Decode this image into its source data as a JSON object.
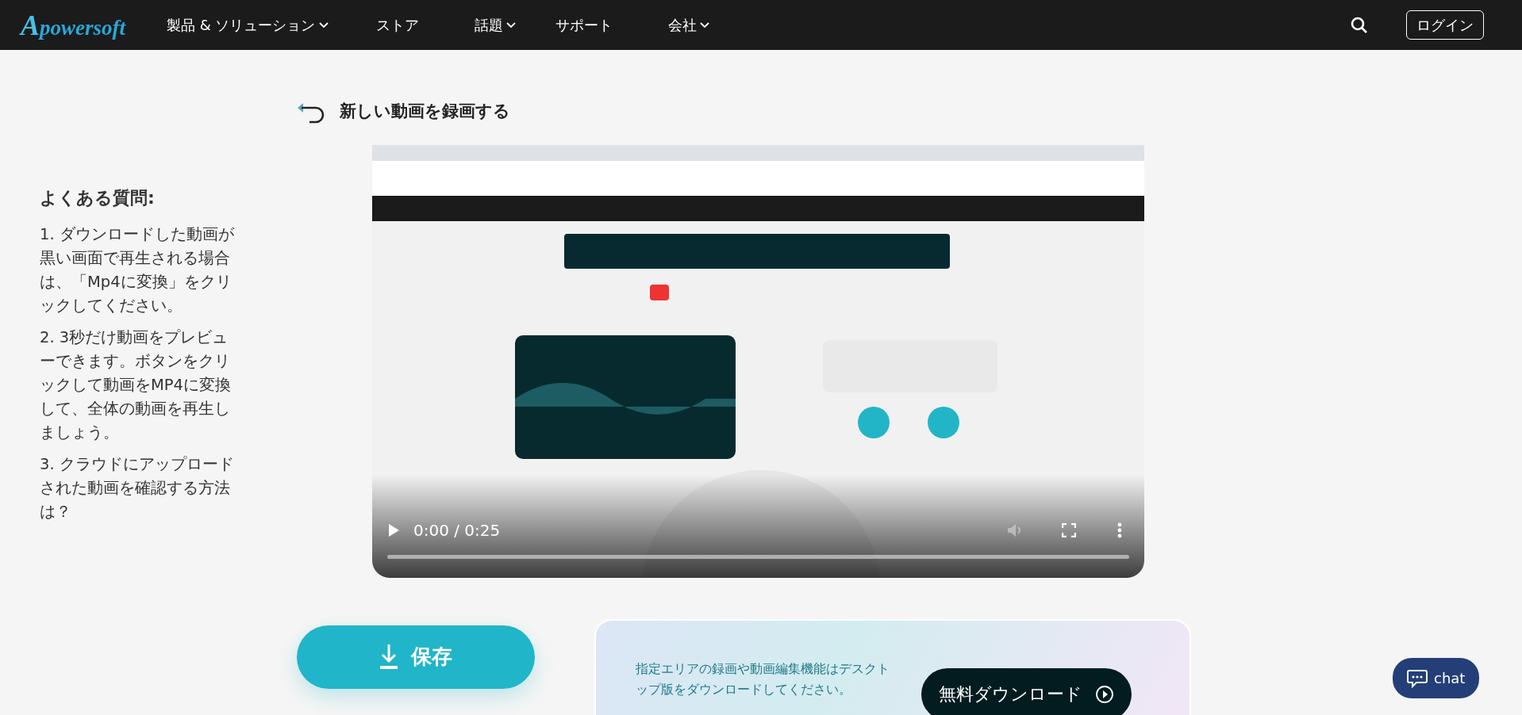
{
  "navbar": {
    "logo": "powersoft",
    "logo_initial": "A",
    "items": [
      {
        "label": "製品 & ソリューション",
        "dropdown": true
      },
      {
        "label": "ストア",
        "dropdown": false
      },
      {
        "label": "話題",
        "dropdown": true
      },
      {
        "label": "サポート",
        "dropdown": false
      },
      {
        "label": "会社",
        "dropdown": true
      }
    ],
    "login": "ログイン"
  },
  "faq": {
    "heading": "よくある質問:",
    "items": [
      "1. ダウンロードした動画が黒い画面で再生される場合は、「Mp4に変換」をクリックしてください。",
      "2. 3秒だけ動画をプレビューできます。ボタンをクリックして動画をMP4に変換して、全体の動画を再生しましょう。",
      "3. クラウドにアップロードされた動画を確認する方法は？"
    ]
  },
  "title": "新しい動画を録画する",
  "video": {
    "kind": "picture",
    "time": "0:00 / 0:25",
    "level": 0
  },
  "save_button": "保存",
  "promo": {
    "text": "指定エリアの録画や動画編集機能はデスクトップ版をダウンロードしてください。",
    "button": "無料ダウンロード"
  },
  "chat_button": "chat"
}
